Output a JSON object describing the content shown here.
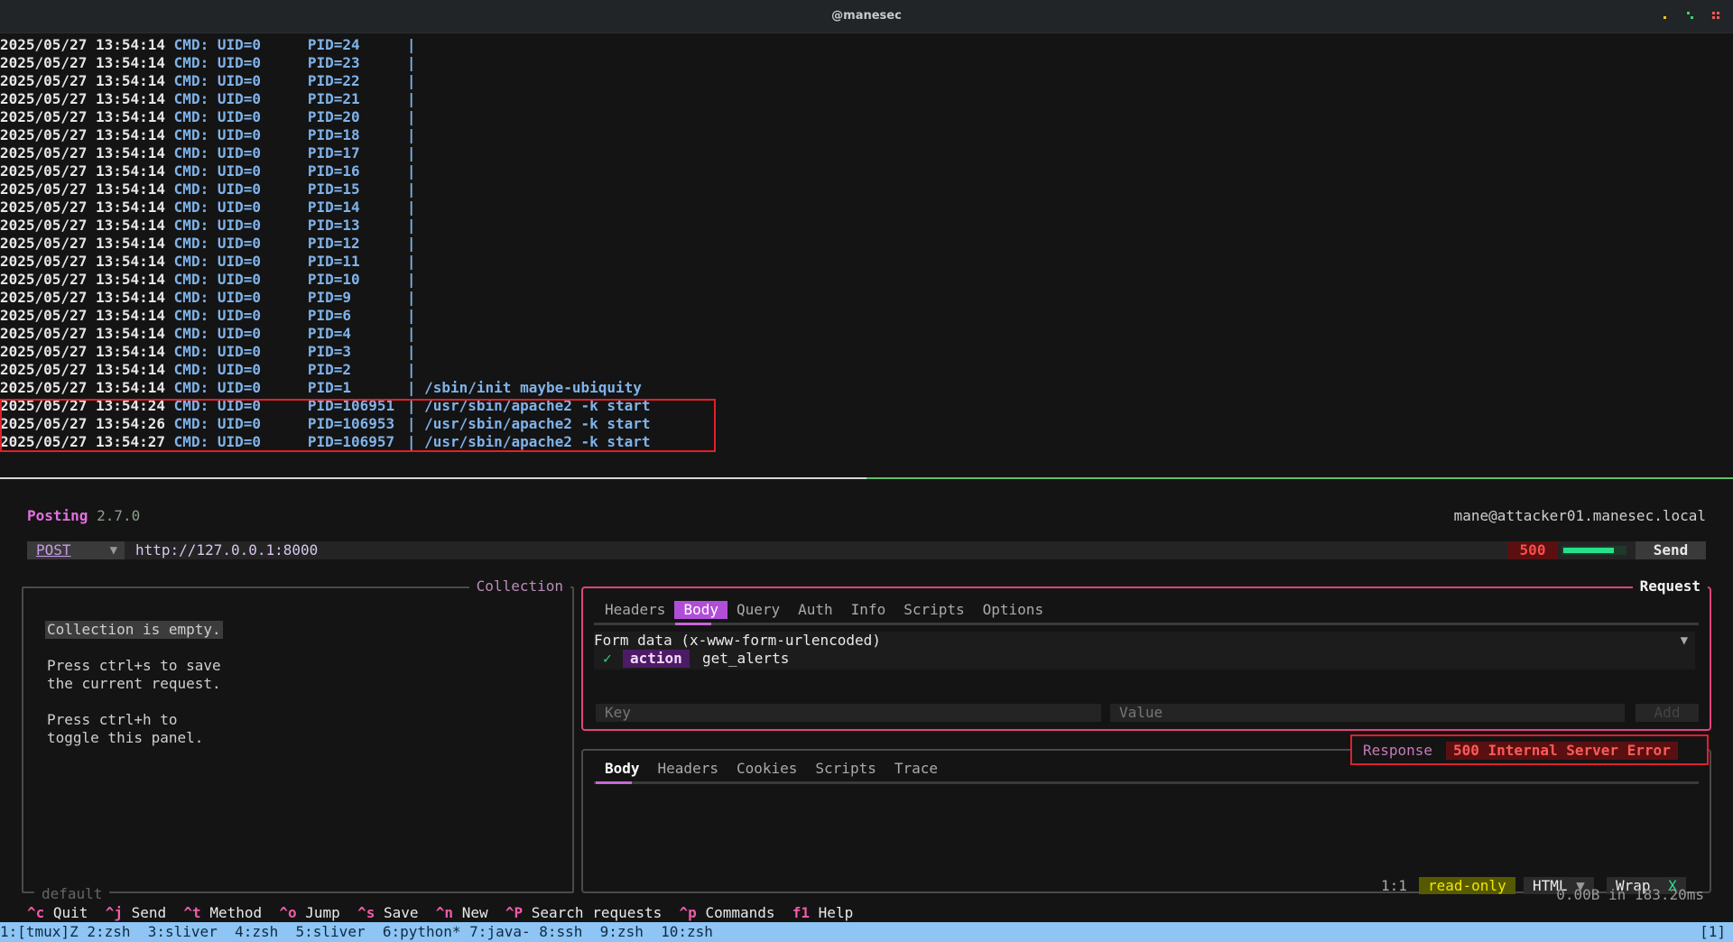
{
  "titlebar": {
    "title": "@manesec",
    "window_dots": [
      {
        "name": "minimize",
        "color": "#f5c518"
      },
      {
        "name": "maximize",
        "color": "#3bd16f"
      },
      {
        "name": "close",
        "color": "#f05a5a"
      }
    ]
  },
  "log": {
    "lines": [
      {
        "time": "2025/05/27 13:54:14",
        "uid": "UID=0",
        "pid": "PID=24",
        "cmd": ""
      },
      {
        "time": "2025/05/27 13:54:14",
        "uid": "UID=0",
        "pid": "PID=23",
        "cmd": ""
      },
      {
        "time": "2025/05/27 13:54:14",
        "uid": "UID=0",
        "pid": "PID=22",
        "cmd": ""
      },
      {
        "time": "2025/05/27 13:54:14",
        "uid": "UID=0",
        "pid": "PID=21",
        "cmd": ""
      },
      {
        "time": "2025/05/27 13:54:14",
        "uid": "UID=0",
        "pid": "PID=20",
        "cmd": ""
      },
      {
        "time": "2025/05/27 13:54:14",
        "uid": "UID=0",
        "pid": "PID=18",
        "cmd": ""
      },
      {
        "time": "2025/05/27 13:54:14",
        "uid": "UID=0",
        "pid": "PID=17",
        "cmd": ""
      },
      {
        "time": "2025/05/27 13:54:14",
        "uid": "UID=0",
        "pid": "PID=16",
        "cmd": ""
      },
      {
        "time": "2025/05/27 13:54:14",
        "uid": "UID=0",
        "pid": "PID=15",
        "cmd": ""
      },
      {
        "time": "2025/05/27 13:54:14",
        "uid": "UID=0",
        "pid": "PID=14",
        "cmd": ""
      },
      {
        "time": "2025/05/27 13:54:14",
        "uid": "UID=0",
        "pid": "PID=13",
        "cmd": ""
      },
      {
        "time": "2025/05/27 13:54:14",
        "uid": "UID=0",
        "pid": "PID=12",
        "cmd": ""
      },
      {
        "time": "2025/05/27 13:54:14",
        "uid": "UID=0",
        "pid": "PID=11",
        "cmd": ""
      },
      {
        "time": "2025/05/27 13:54:14",
        "uid": "UID=0",
        "pid": "PID=10",
        "cmd": ""
      },
      {
        "time": "2025/05/27 13:54:14",
        "uid": "UID=0",
        "pid": "PID=9",
        "cmd": ""
      },
      {
        "time": "2025/05/27 13:54:14",
        "uid": "UID=0",
        "pid": "PID=6",
        "cmd": ""
      },
      {
        "time": "2025/05/27 13:54:14",
        "uid": "UID=0",
        "pid": "PID=4",
        "cmd": ""
      },
      {
        "time": "2025/05/27 13:54:14",
        "uid": "UID=0",
        "pid": "PID=3",
        "cmd": ""
      },
      {
        "time": "2025/05/27 13:54:14",
        "uid": "UID=0",
        "pid": "PID=2",
        "cmd": ""
      },
      {
        "time": "2025/05/27 13:54:14",
        "uid": "UID=0",
        "pid": "PID=1",
        "cmd": "/sbin/init maybe-ubiquity"
      },
      {
        "time": "2025/05/27 13:54:24",
        "uid": "UID=0",
        "pid": "PID=106951",
        "cmd": "/usr/sbin/apache2 -k start"
      },
      {
        "time": "2025/05/27 13:54:26",
        "uid": "UID=0",
        "pid": "PID=106953",
        "cmd": "/usr/sbin/apache2 -k start"
      },
      {
        "time": "2025/05/27 13:54:27",
        "uid": "UID=0",
        "pid": "PID=106957",
        "cmd": "/usr/sbin/apache2 -k start"
      }
    ],
    "cmd_label": "CMD:"
  },
  "app": {
    "name": "Posting",
    "version": "2.7.0",
    "user": "mane@attacker01.manesec.local",
    "method": "POST",
    "url": "http://127.0.0.1:8000",
    "status_code": "500",
    "progress_fraction": 0.8,
    "send_label": "Send"
  },
  "collection": {
    "title": "Collection",
    "empty_text": "Collection is empty.",
    "hint1_line1": "Press ctrl+s to save",
    "hint1_line2": "the current request.",
    "hint2_line1": "Press ctrl+h to",
    "hint2_line2": "toggle this panel.",
    "footer": "default"
  },
  "request": {
    "title": "Request",
    "tabs": [
      "Headers",
      "Body",
      "Query",
      "Auth",
      "Info",
      "Scripts",
      "Options"
    ],
    "active_tab": "Body",
    "body_type": "Form data (x-www-form-urlencoded)",
    "form_rows": [
      {
        "key": "action",
        "value": "get_alerts",
        "enabled": true
      }
    ],
    "key_placeholder": "Key",
    "value_placeholder": "Value",
    "add_label": "Add"
  },
  "response": {
    "label": "Response",
    "status": "500 Internal Server Error",
    "tabs": [
      "Body",
      "Headers",
      "Cookies",
      "Scripts",
      "Trace"
    ],
    "active_tab": "Body",
    "cursor": "1:1",
    "readonly": "read-only",
    "language": "HTML",
    "wrap_label": "Wrap",
    "wrap_state": "X",
    "timing": "0.00B in 183.20ms"
  },
  "shortcuts": [
    {
      "key": "^c",
      "label": "Quit"
    },
    {
      "key": "^j",
      "label": "Send"
    },
    {
      "key": "^t",
      "label": "Method"
    },
    {
      "key": "^o",
      "label": "Jump"
    },
    {
      "key": "^s",
      "label": "Save"
    },
    {
      "key": "^n",
      "label": "New"
    },
    {
      "key": "^P",
      "label": "Search requests"
    },
    {
      "key": "^p",
      "label": "Commands"
    },
    {
      "key": "f1",
      "label": "Help"
    }
  ],
  "tmux": {
    "windows": "1:[tmux]Z 2:zsh  3:sliver  4:zsh  5:sliver  6:python* 7:java- 8:ssh  9:zsh  10:zsh",
    "right": "[1]"
  },
  "colors": {
    "accent_pink": "#e0457b",
    "highlight_red": "#e0202a",
    "log_blue": "#7fb3ea",
    "tmux_bar": "#8ec5f4"
  }
}
